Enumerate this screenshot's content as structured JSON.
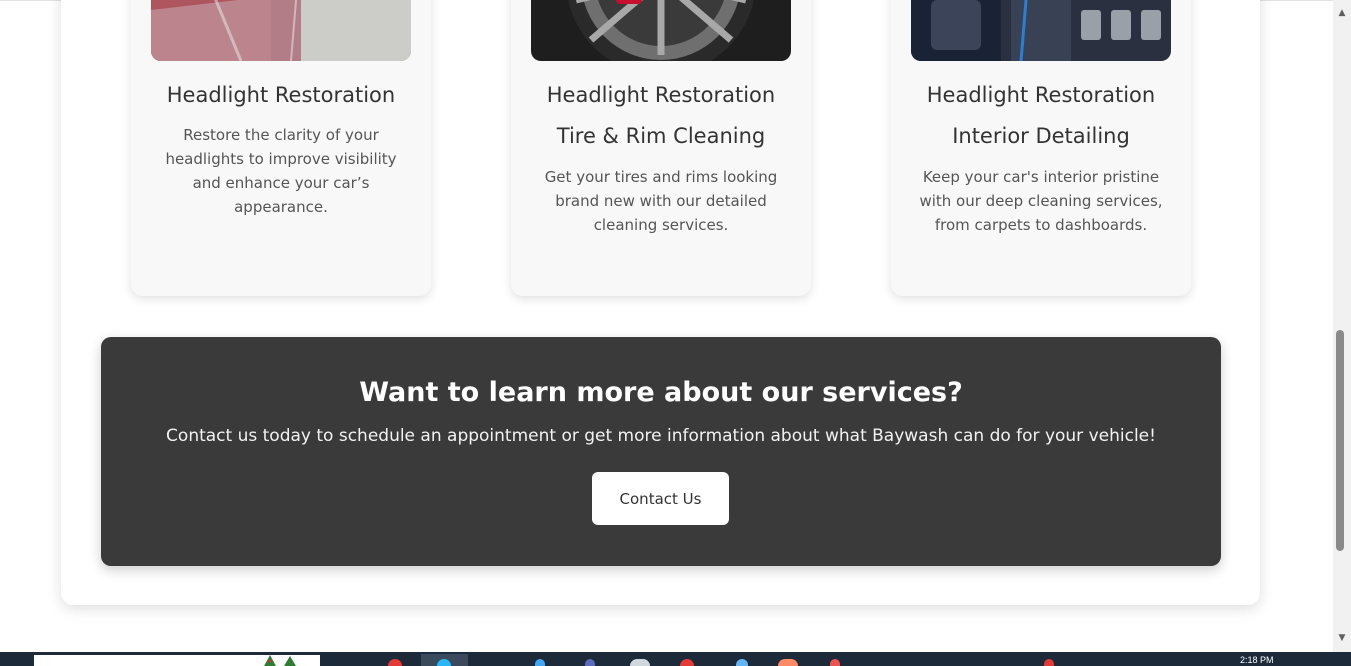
{
  "services": [
    {
      "image_alt": "car seat covered in protective plastic",
      "titles": [
        "Headlight Restoration"
      ],
      "description": "Restore the clarity of your headlights to improve visibility and enhance your car’s appearance."
    },
    {
      "image_alt": "tire rim being cleaned with spray bottle",
      "titles": [
        "Headlight Restoration",
        "Tire & Rim Cleaning"
      ],
      "description": "Get your tires and rims looking brand new with our detailed cleaning services."
    },
    {
      "image_alt": "car interior dashboard being cleaned",
      "titles": [
        "Headlight Restoration",
        "Interior Detailing"
      ],
      "description": "Keep your car's interior pristine with our deep cleaning services, from carpets to dashboards."
    }
  ],
  "cta": {
    "title": "Want to learn more about our services?",
    "text": "Contact us today to schedule an appointment or get more information about what Baywash can do for your vehicle!",
    "button_label": "Contact Us"
  },
  "taskbar": {
    "clock": "2:18 PM"
  },
  "icons": {
    "scroll_up": "up-arrow-icon",
    "scroll_down": "down-arrow-icon"
  }
}
